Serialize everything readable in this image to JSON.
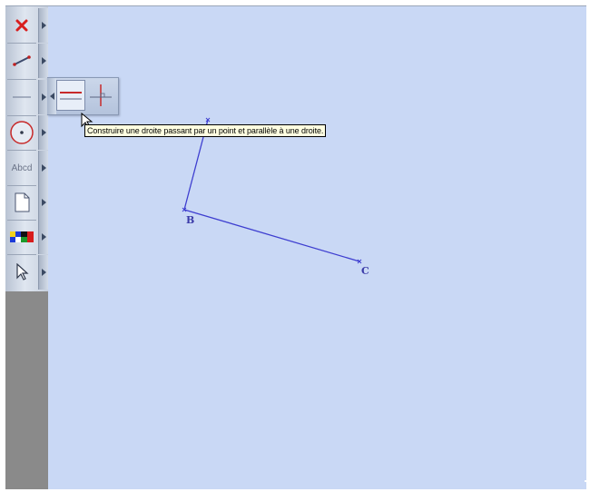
{
  "toolbar": {
    "tools": [
      {
        "name": "delete-tool",
        "icon": "red-x-icon"
      },
      {
        "name": "segment-tool",
        "icon": "segment-icon"
      },
      {
        "name": "line-tool",
        "icon": "line-icon"
      },
      {
        "name": "circle-tool",
        "icon": "circle-icon"
      },
      {
        "name": "measure-tool",
        "icon": "measure-icon",
        "label": "Abcd"
      },
      {
        "name": "new-document-tool",
        "icon": "document-icon"
      },
      {
        "name": "color-tool",
        "icon": "color-palette-icon"
      },
      {
        "name": "pointer-tool",
        "icon": "pointer-icon"
      }
    ]
  },
  "flyout": {
    "buttons": [
      {
        "name": "parallel-line-button",
        "icon": "parallel-line-icon"
      },
      {
        "name": "perpendicular-line-button",
        "icon": "perpendicular-line-icon"
      }
    ]
  },
  "tooltip": {
    "text": "Construire une droite passant par un point et parallèle à une droite."
  },
  "figure": {
    "points": [
      {
        "label": ""
      },
      {
        "label": "B"
      },
      {
        "label": "C"
      }
    ],
    "stroke_color": "#3e3ed0",
    "label_color": "#3a3aa8"
  },
  "colors": {
    "canvas": "#c9d8f5",
    "tooltip_bg": "#ffffe1",
    "toolbar_bg": "#8a8a8a"
  }
}
